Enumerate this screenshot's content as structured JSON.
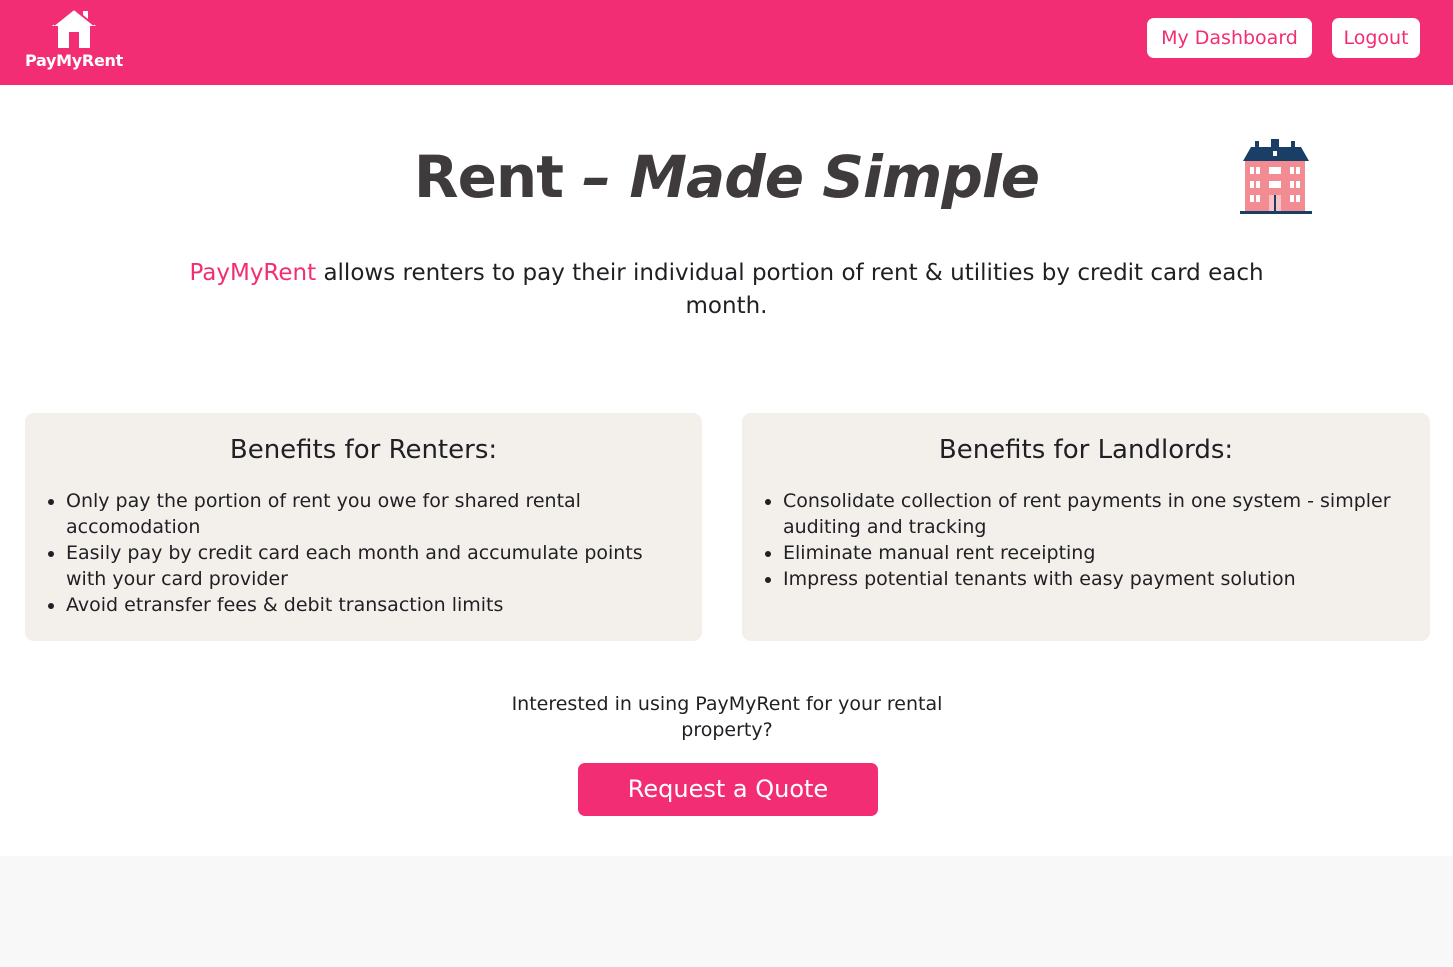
{
  "header": {
    "logo_text": "PayMyRent",
    "dashboard_label": "My Dashboard",
    "logout_label": "Logout"
  },
  "hero": {
    "title_plain": "Rent",
    "title_italic": "– Made Simple",
    "intro_brand": "PayMyRent",
    "intro_text": " allows renters to pay their individual portion of rent & utilities by credit card each month."
  },
  "renters": {
    "title": "Benefits for Renters:",
    "items": [
      "Only pay the portion of rent you owe for shared rental accomodation",
      "Easily pay by credit card each month and accumulate points with your card provider",
      "Avoid etransfer fees & debit transaction limits"
    ]
  },
  "landlords": {
    "title": "Benefits for Landlords:",
    "items": [
      "Consolidate collection of rent payments in one system - simpler auditing and tracking",
      "Eliminate manual rent receipting",
      "Impress potential tenants with easy payment solution"
    ]
  },
  "cta": {
    "text": "Interested in using PayMyRent for your rental property?",
    "button_label": "Request a Quote"
  },
  "colors": {
    "brand": "#f32d73",
    "card_background": "#f3efeb",
    "heading_text": "#3f3b3c"
  },
  "icons": {
    "logo": "house-icon",
    "hero": "apartment-building-icon"
  }
}
